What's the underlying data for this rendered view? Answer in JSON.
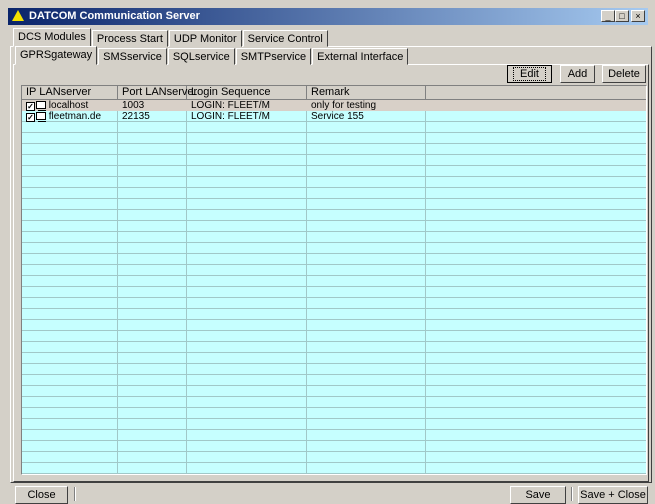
{
  "window": {
    "title": "DATCOM Communication Server",
    "controls": {
      "minimize": "_",
      "maximize": "□",
      "close": "×"
    }
  },
  "main_tabs": [
    "DCS Modules",
    "Process Start",
    "UDP Monitor",
    "Service Control"
  ],
  "sub_tabs": [
    "GPRSgateway",
    "SMSservice",
    "SQLservice",
    "SMTPservice",
    "External Interface"
  ],
  "toolbar": {
    "edit": "Edit",
    "add": "Add",
    "delete": "Delete"
  },
  "table": {
    "columns": [
      "IP LANserver",
      "Port LANserver",
      "Login Sequence",
      "Remark"
    ],
    "rows": [
      {
        "checked": true,
        "host": "localhost",
        "port": "1003",
        "login": "LOGIN: FLEET/M",
        "remark": "only for testing"
      },
      {
        "checked": true,
        "host": "fleetman.de",
        "port": "22135",
        "login": "LOGIN: FLEET/M",
        "remark": "Service 155"
      }
    ]
  },
  "footer": {
    "close": "Close",
    "save": "Save",
    "save_close": "Save + Close"
  },
  "colors": {
    "grid_bg": "#c6ffff",
    "title_start": "#0a246a",
    "title_end": "#a6caf0"
  }
}
